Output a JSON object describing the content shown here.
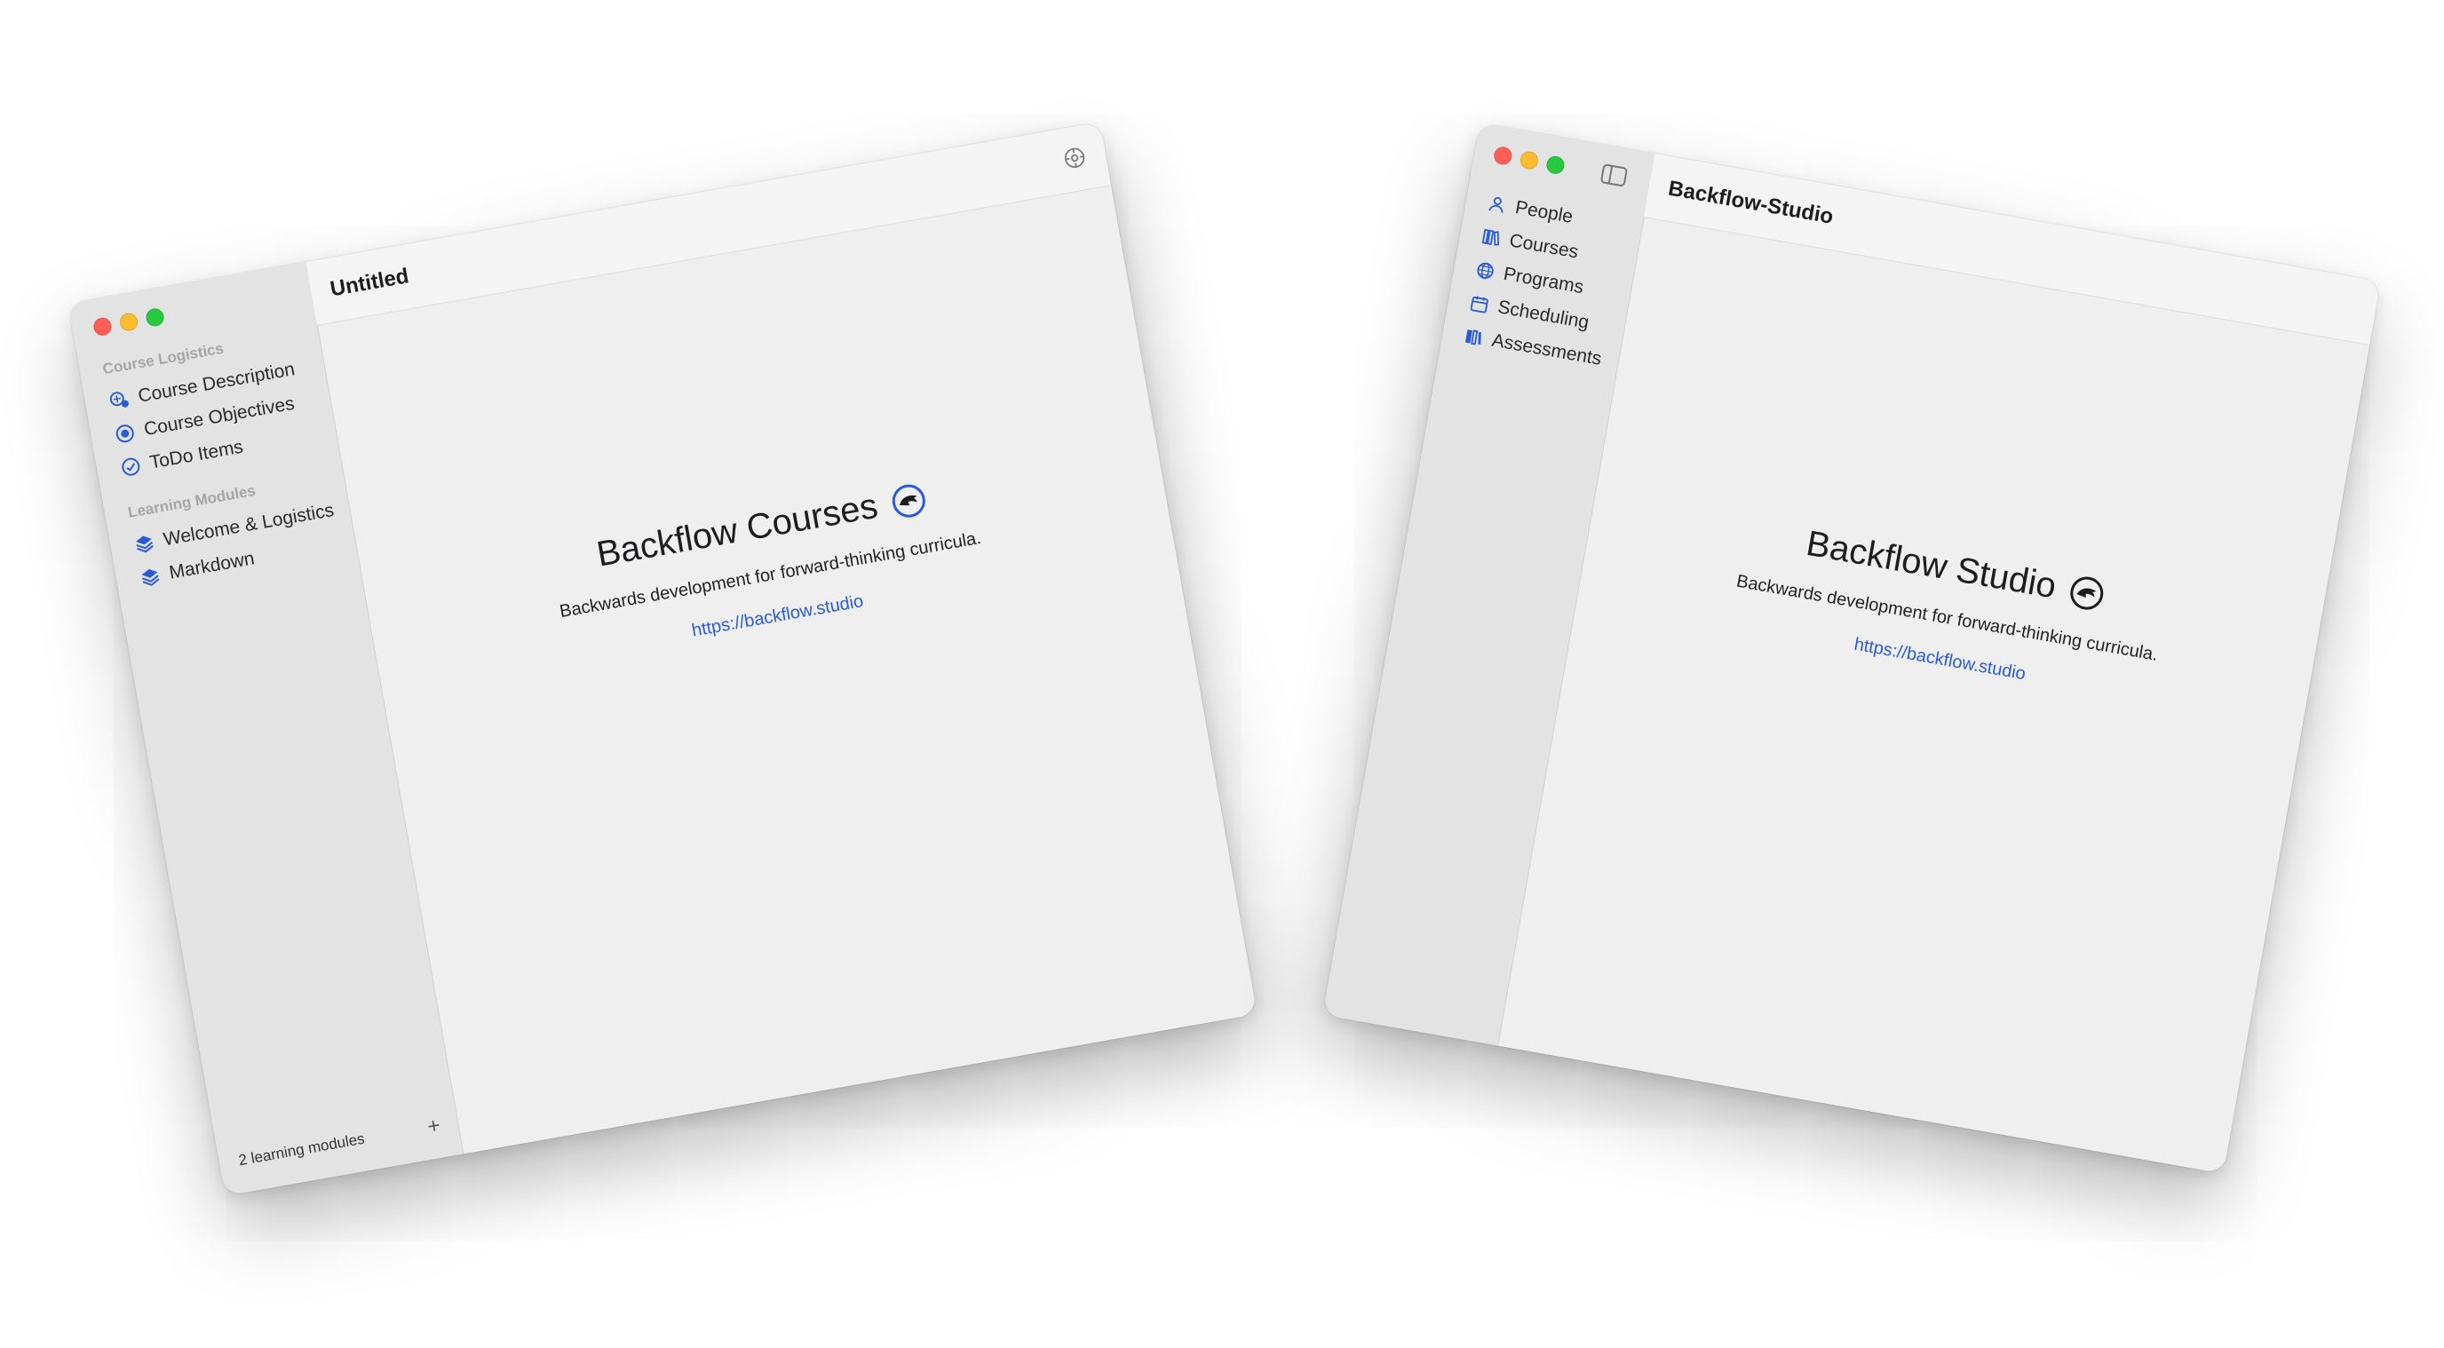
{
  "courses_window": {
    "title": "Untitled",
    "sidebar": {
      "sections": [
        {
          "header": "Course Logistics",
          "items": [
            {
              "label": "Course Description",
              "icon": "course-description-icon"
            },
            {
              "label": "Course Objectives",
              "icon": "target-icon"
            },
            {
              "label": "ToDo Items",
              "icon": "checkmark-circle-icon"
            }
          ]
        },
        {
          "header": "Learning Modules",
          "items": [
            {
              "label": "Welcome & Logistics",
              "icon": "stack-icon"
            },
            {
              "label": "Markdown",
              "icon": "stack-icon"
            }
          ]
        }
      ],
      "footer_text": "2 learning modules",
      "add_label": "+"
    },
    "welcome": {
      "title": "Backflow Courses",
      "tagline": "Backwards development for forward-thinking curricula.",
      "link": "https://backflow.studio"
    }
  },
  "studio_window": {
    "title": "Backflow-Studio",
    "sidebar": {
      "items": [
        {
          "label": "People",
          "icon": "person-icon"
        },
        {
          "label": "Courses",
          "icon": "books-icon"
        },
        {
          "label": "Programs",
          "icon": "globe-icon"
        },
        {
          "label": "Scheduling",
          "icon": "calendar-icon"
        },
        {
          "label": "Assessments",
          "icon": "assessments-icon"
        }
      ]
    },
    "welcome": {
      "title": "Backflow Studio",
      "tagline": "Backwards development for forward-thinking curricula.",
      "link": "https://backflow.studio"
    }
  },
  "colors": {
    "accent": "#2a5bd7",
    "sidebar_bg": "#e3e3e3",
    "content_bg": "#efefef",
    "traffic_red": "#ff5f57",
    "traffic_yellow": "#febc2e",
    "traffic_green": "#28c840"
  }
}
